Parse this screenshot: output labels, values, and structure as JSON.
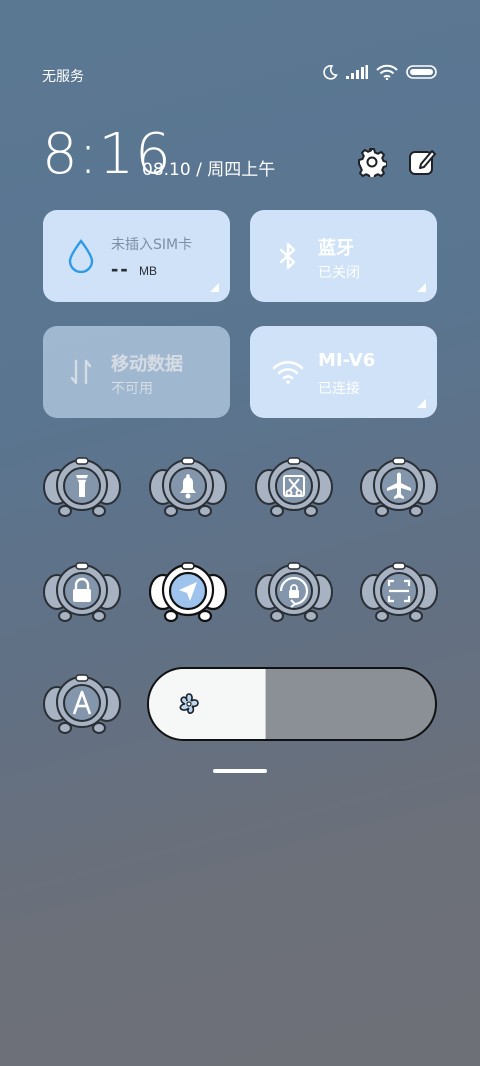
{
  "status_bar": {
    "carrier": "无服务",
    "icons": [
      "moon-icon",
      "signal-icon",
      "wifi-icon",
      "battery-icon"
    ]
  },
  "header": {
    "time": "8:16",
    "date": "08.10 / 周四上午",
    "actions": [
      "settings-gear-icon",
      "edit-icon"
    ]
  },
  "tiles": {
    "sim": {
      "title": "未插入SIM卡",
      "value": "--",
      "unit": "MB",
      "icon": "water-drop-icon",
      "accent": "#2f9be8"
    },
    "bluetooth": {
      "title": "蓝牙",
      "status": "已关闭",
      "icon": "bluetooth-icon"
    },
    "mobile_data": {
      "title": "移动数据",
      "status": "不可用",
      "icon": "data-arrows-icon"
    },
    "wifi": {
      "title": "MI-V6",
      "status": "已连接",
      "icon": "wifi-icon"
    }
  },
  "toggles": [
    {
      "id": "flashlight",
      "icon": "flashlight-icon",
      "active": false
    },
    {
      "id": "ringer",
      "icon": "bell-icon",
      "active": false
    },
    {
      "id": "screenshot",
      "icon": "scissors-icon",
      "active": false
    },
    {
      "id": "airplane",
      "icon": "airplane-icon",
      "active": false
    },
    {
      "id": "lock",
      "icon": "lock-icon",
      "active": false
    },
    {
      "id": "location",
      "icon": "location-arrow-icon",
      "active": true
    },
    {
      "id": "rotation-lock",
      "icon": "rotation-lock-icon",
      "active": false
    },
    {
      "id": "scanner",
      "icon": "scan-icon",
      "active": false
    },
    {
      "id": "auto-brightness",
      "icon": "letter-a-icon",
      "active": false
    }
  ],
  "brightness": {
    "level": 0.41,
    "icon": "sun-flower-icon"
  },
  "colors": {
    "tile_bg": "#cfe2f7",
    "elephant_gray": "#a7b3c2",
    "elephant_active": "#ffffff",
    "outline": "#2b2f36"
  }
}
